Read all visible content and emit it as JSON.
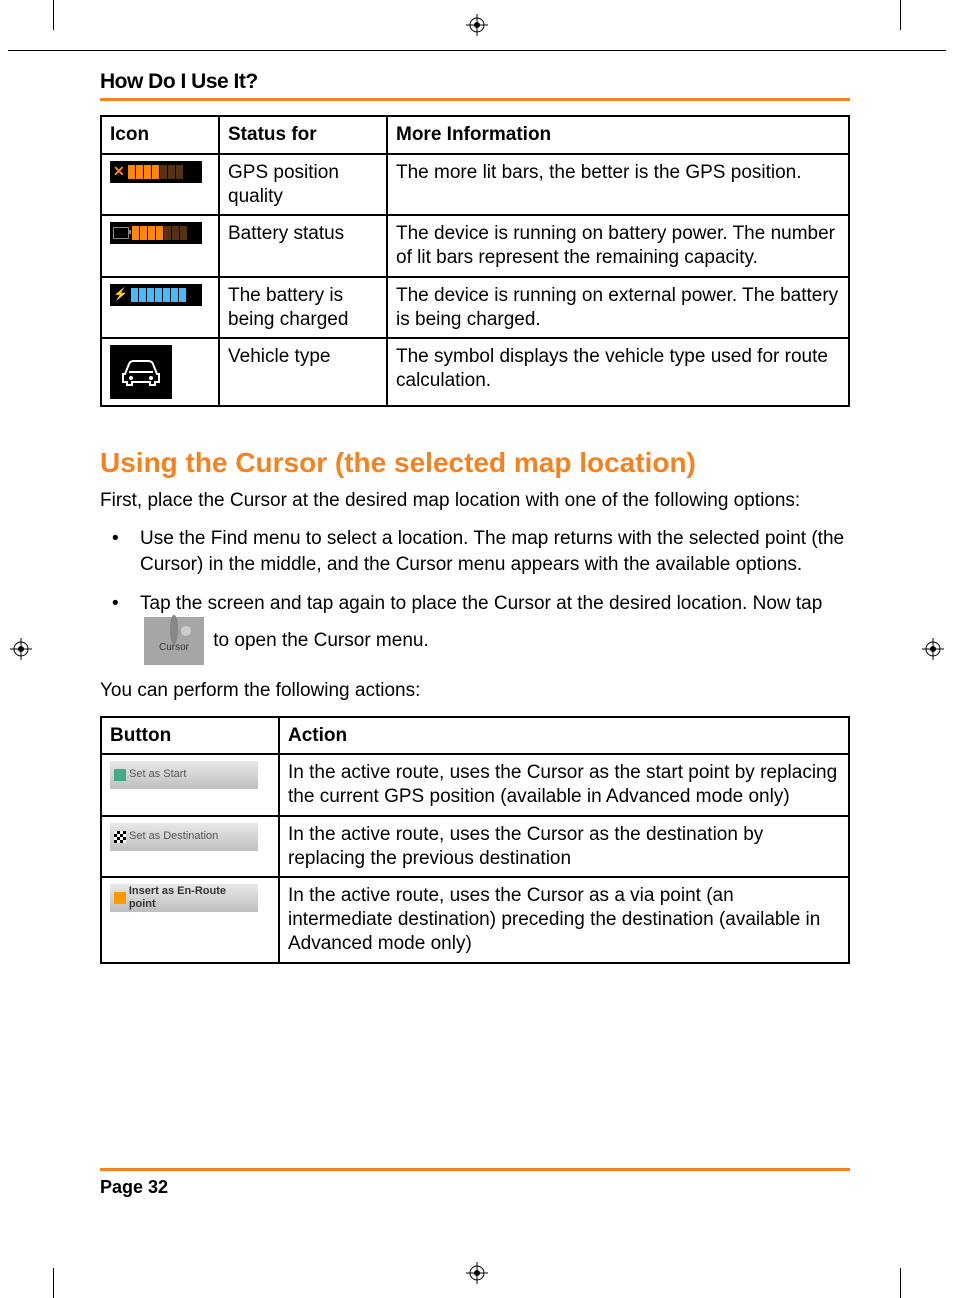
{
  "header": {
    "title": "How Do I Use It?"
  },
  "table1": {
    "headers": {
      "icon": "Icon",
      "status": "Status for",
      "info": "More Information"
    },
    "rows": [
      {
        "status": "GPS position quality",
        "info": "The more lit bars, the better is the GPS position."
      },
      {
        "status": "Battery status",
        "info": "The device is running on battery power. The number of lit bars represent the remaining capacity."
      },
      {
        "status": "The battery is being charged",
        "info": " The device is running on external power. The battery is being charged."
      },
      {
        "status": "Vehicle type",
        "info": "The symbol displays the vehicle type used for route calculation."
      }
    ]
  },
  "section": {
    "heading": "Using the Cursor (the selected map location)",
    "intro": "First, place the Cursor at the desired map location with one of the following options:",
    "bullet1": "Use the Find menu to select a location. The map returns with the selected point (the Cursor) in the middle, and the Cursor menu appears with the available options.",
    "bullet2_a": "Tap the screen and tap again to place the Cursor at the desired location. Now tap ",
    "bullet2_b": " to open the Cursor menu.",
    "cursor_btn_label": "Cursor",
    "after": "You can perform the following actions:"
  },
  "table2": {
    "headers": {
      "button": "Button",
      "action": "Action"
    },
    "rows": [
      {
        "btn": "Set as Start",
        "action": "In the active route, uses the Cursor as the start point by replacing the current GPS position (available in Advanced mode only)"
      },
      {
        "btn": "Set as Destination",
        "action": "In the active route, uses the Cursor as the destination by replacing the previous destination"
      },
      {
        "btn": "Insert as En-Route point",
        "action": "In the active route, uses the Cursor as a via point (an intermediate destination) preceding the destination (available in Advanced mode only)"
      }
    ]
  },
  "footer": {
    "page": "Page 32"
  }
}
